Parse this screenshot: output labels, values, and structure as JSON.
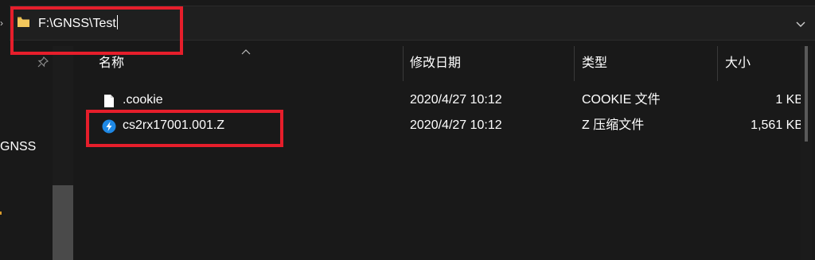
{
  "address_bar": {
    "path": "F:\\GNSS\\Test"
  },
  "navigation": {
    "visible_item_label": "GNSS"
  },
  "columns": {
    "name": "名称",
    "modified": "修改日期",
    "type": "类型",
    "size": "大小"
  },
  "files": [
    {
      "name": ".cookie",
      "modified": "2020/4/27 10:12",
      "type": "COOKIE 文件",
      "size": "1 KB",
      "icon": "blank-file-icon"
    },
    {
      "name": "cs2rx17001.001.Z",
      "modified": "2020/4/27 10:12",
      "type": "Z 压缩文件",
      "size": "1,561 KB",
      "icon": "archive-app-icon"
    }
  ],
  "colors": {
    "background": "#191919",
    "highlight": "#e61e2b",
    "folder": "#f2c75c",
    "archive_icon": "#1e88e5"
  }
}
